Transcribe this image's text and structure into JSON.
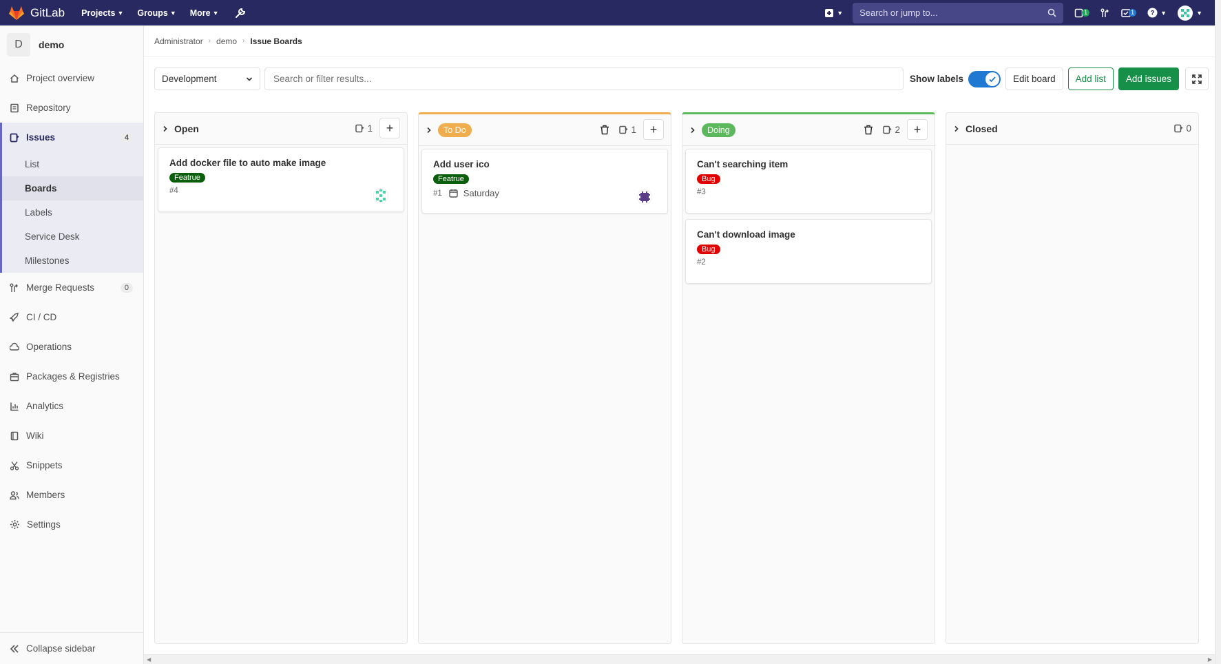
{
  "navbar": {
    "brand": "GitLab",
    "menu": [
      {
        "label": "Projects"
      },
      {
        "label": "Groups"
      },
      {
        "label": "More"
      }
    ],
    "search_placeholder": "Search or jump to...",
    "issues_badge": "1",
    "todos_badge": "1",
    "colors": {
      "bg": "#292961"
    }
  },
  "sidebar": {
    "project_avatar": "D",
    "project_name": "demo",
    "items": [
      {
        "label": "Project overview",
        "icon": "home-icon"
      },
      {
        "label": "Repository",
        "icon": "doc-icon"
      }
    ],
    "issues": {
      "label": "Issues",
      "count": "4",
      "sub": [
        {
          "label": "List"
        },
        {
          "label": "Boards"
        },
        {
          "label": "Labels"
        },
        {
          "label": "Service Desk"
        },
        {
          "label": "Milestones"
        }
      ]
    },
    "items2": [
      {
        "label": "Merge Requests",
        "count": "0"
      },
      {
        "label": "CI / CD"
      },
      {
        "label": "Operations"
      },
      {
        "label": "Packages & Registries"
      },
      {
        "label": "Analytics"
      },
      {
        "label": "Wiki"
      },
      {
        "label": "Snippets"
      },
      {
        "label": "Members"
      },
      {
        "label": "Settings"
      }
    ],
    "collapse": "Collapse sidebar"
  },
  "breadcrumb": {
    "items": [
      "Administrator",
      "demo",
      "Issue Boards"
    ]
  },
  "toolbar": {
    "board_select": "Development",
    "filter_placeholder": "Search or filter results...",
    "show_labels": "Show labels",
    "edit_board": "Edit board",
    "add_list": "Add list",
    "add_issues": "Add issues"
  },
  "board": {
    "columns": [
      {
        "title": "Open",
        "count": "1",
        "cards": [
          {
            "title": "Add docker file to auto make image",
            "label": "Featrue",
            "label_color": "#0b5e0b",
            "ref": "#4"
          }
        ]
      },
      {
        "title": "To Do",
        "label_color": "#f0ad4e",
        "count": "1",
        "cards": [
          {
            "title": "Add user ico",
            "label": "Featrue",
            "label_color": "#0b5e0b",
            "ref": "#1",
            "due": "Saturday"
          }
        ]
      },
      {
        "title": "Doing",
        "label_color": "#5cb85c",
        "count": "2",
        "cards": [
          {
            "title": "Can't searching item",
            "label": "Bug",
            "label_color": "#e00000",
            "ref": "#3"
          },
          {
            "title": "Can't download image",
            "label": "Bug",
            "label_color": "#e00000",
            "ref": "#2"
          }
        ]
      },
      {
        "title": "Closed",
        "count": "0",
        "cards": []
      }
    ]
  }
}
